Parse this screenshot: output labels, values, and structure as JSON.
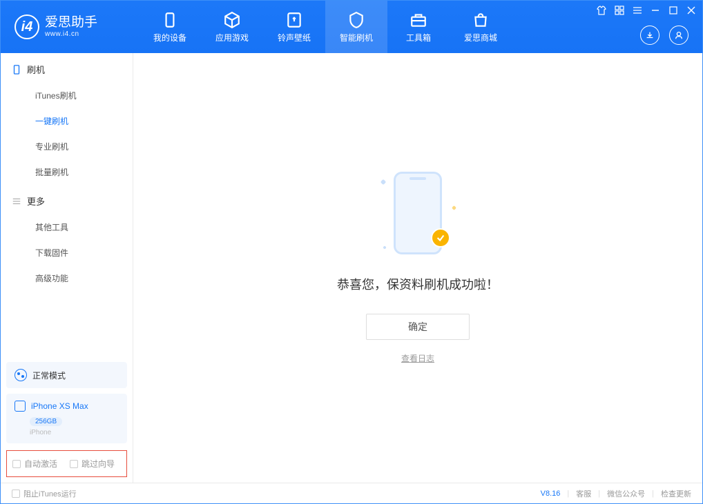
{
  "app": {
    "title": "爱思助手",
    "subtitle": "www.i4.cn"
  },
  "nav": [
    {
      "label": "我的设备"
    },
    {
      "label": "应用游戏"
    },
    {
      "label": "铃声壁纸"
    },
    {
      "label": "智能刷机"
    },
    {
      "label": "工具箱"
    },
    {
      "label": "爱思商城"
    }
  ],
  "sidebar": {
    "group1": {
      "title": "刷机",
      "items": [
        "iTunes刷机",
        "一键刷机",
        "专业刷机",
        "批量刷机"
      ]
    },
    "group2": {
      "title": "更多",
      "items": [
        "其他工具",
        "下载固件",
        "高级功能"
      ]
    },
    "status": {
      "mode": "正常模式"
    },
    "device": {
      "name": "iPhone XS Max",
      "storage": "256GB",
      "type": "iPhone"
    },
    "checkboxes": {
      "auto_activate": "自动激活",
      "skip_guide": "跳过向导"
    }
  },
  "main": {
    "success_message": "恭喜您，保资料刷机成功啦！",
    "ok_button": "确定",
    "view_log": "查看日志"
  },
  "footer": {
    "block_itunes": "阻止iTunes运行",
    "version": "V8.16",
    "links": [
      "客服",
      "微信公众号",
      "检查更新"
    ]
  }
}
